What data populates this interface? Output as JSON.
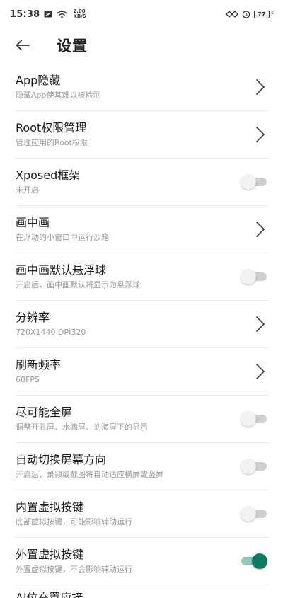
{
  "status": {
    "time": "15:38",
    "net_speed_value": "2.00",
    "net_speed_unit": "KB/S",
    "battery": "77"
  },
  "header": {
    "title": "设置"
  },
  "settings": [
    {
      "title": "App隐藏",
      "subtitle": "隐藏App使其难以被检测",
      "control": "chevron"
    },
    {
      "title": "Root权限管理",
      "subtitle": "管理应用的Root权限",
      "control": "chevron"
    },
    {
      "title": "Xposed框架",
      "subtitle": "未开启",
      "control": "toggle",
      "on": false
    },
    {
      "title": "画中画",
      "subtitle": "在浮动的小窗口中运行沙箱",
      "control": "chevron"
    },
    {
      "title": "画中画默认悬浮球",
      "subtitle": "开启后，画中画默认将显示为悬浮球",
      "control": "toggle",
      "on": false
    },
    {
      "title": "分辨率",
      "subtitle": "720X1440 DPI320",
      "control": "chevron"
    },
    {
      "title": "刷新频率",
      "subtitle": "60FPS",
      "control": "chevron"
    },
    {
      "title": "尽可能全屏",
      "subtitle": "调整开孔屏、水滴屏、刘海屏下的显示",
      "control": "toggle",
      "on": false
    },
    {
      "title": "自动切换屏幕方向",
      "subtitle": "开启后，录频或截图将自动适应横屏或竖屏",
      "control": "toggle",
      "on": false
    },
    {
      "title": "内置虚拟按键",
      "subtitle": "底部虚拟按键，可能影响辅助运行",
      "control": "toggle",
      "on": false
    },
    {
      "title": "外置虚拟按键",
      "subtitle": "外置虚拟按键，不会影响辅助运行",
      "control": "toggle",
      "on": true
    }
  ],
  "partial_next_item": "Al位充置应接",
  "colors": {
    "accent": "#0e7a60",
    "accent_track": "#8ec8b6",
    "toggle_off_track": "#cfcfcf",
    "divider": "#ececec",
    "subtitle": "#9a9a9a"
  }
}
